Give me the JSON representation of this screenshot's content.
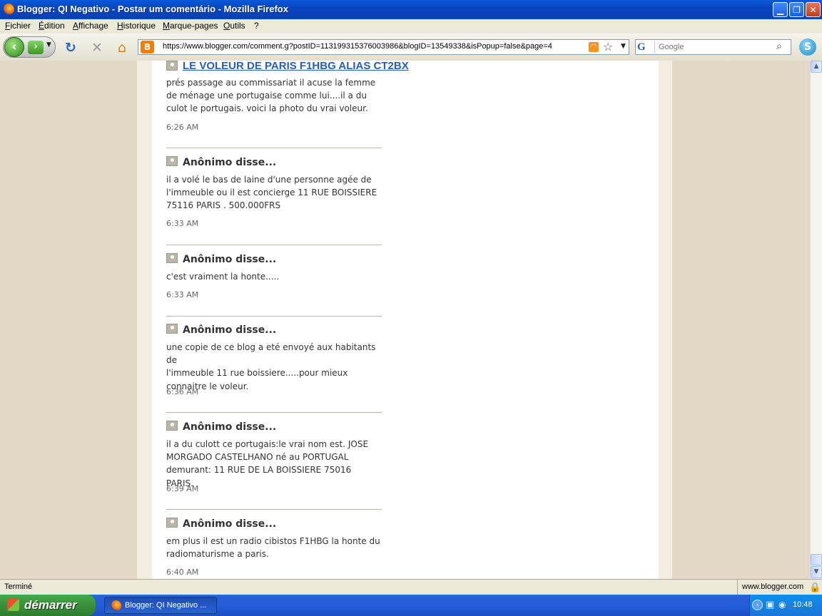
{
  "window": {
    "title": "Blogger: QI Negativo - Postar um comentário - Mozilla Firefox",
    "minimize": "0",
    "maximize": "1",
    "close": "✕"
  },
  "menu": {
    "items": [
      "Fichier",
      "Édition",
      "Affichage",
      "Historique",
      "Marque-pages",
      "Outils",
      "?"
    ]
  },
  "toolbar": {
    "url": "https://www.blogger.com/comment.g?postID=113199315376003986&blogID=13549338&isPopup=false&page=4",
    "search_placeholder": "Google",
    "engine": "G",
    "site_badge": "B"
  },
  "comments": [
    {
      "author": "LE VOLEUR DE PARIS F1HBG ALIAS CT2BX",
      "lines": [
        "prés passage au commissariat il acuse la femme",
        "de ménage une portugaise comme lui....il a du",
        "culot le portugais. voici la photo du vrai voleur."
      ],
      "time": "6:26 AM"
    },
    {
      "author": "Anônimo disse...",
      "lines": [
        "il a volé le bas de laine d'une personne agée de",
        "l'immeuble ou il est concierge 11 RUE BOISSIERE",
        "75116 PARIS . 500.000FRS"
      ],
      "time": "6:33 AM"
    },
    {
      "author": "Anônimo disse...",
      "lines": [
        "c'est vraiment la honte....."
      ],
      "time": "6:33 AM"
    },
    {
      "author": "Anônimo disse...",
      "lines": [
        "une copie de ce blog a eté envoyé aux habitants de",
        "l'immeuble 11 rue boissiere.....pour mieux",
        "connaitre le voleur."
      ],
      "time": "6:36 AM"
    },
    {
      "author": "Anônimo disse...",
      "lines": [
        "il a du culott ce portugais:le vrai nom est. JOSE",
        "MORGADO CASTELHANO né au PORTUGAL",
        "demurant: 11 RUE DE LA BOISSIERE 75016 PARIS."
      ],
      "time": "6:39 AM"
    },
    {
      "author": "Anônimo disse...",
      "lines": [
        "em plus il est un radio cibistos F1HBG la honte du",
        "radiomaturisme a paris."
      ],
      "time": "6:40 AM"
    }
  ],
  "status": {
    "text": "Terminé",
    "site": "www.blogger.com"
  },
  "taskbar": {
    "start_label": "démarrer",
    "task_label": "Blogger: QI Negativo ...",
    "clock": "10:48"
  },
  "colors": {
    "link": "#2a5db0",
    "page_background": "#e4d9c6"
  }
}
